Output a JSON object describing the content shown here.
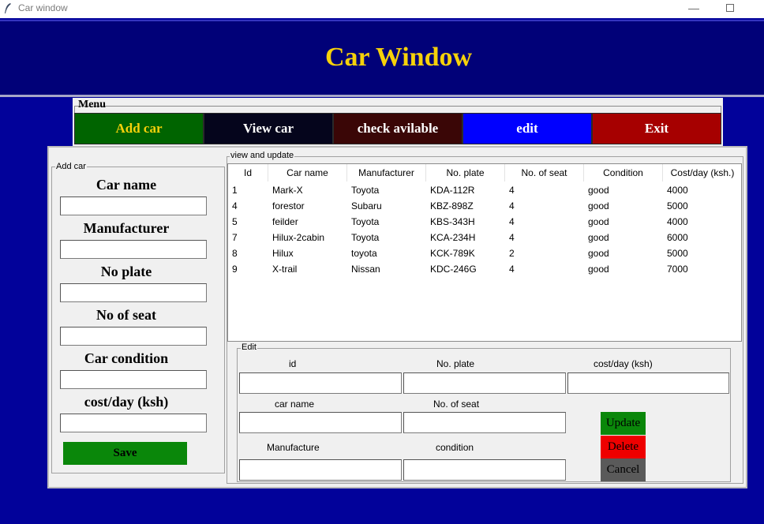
{
  "window": {
    "title": "Car window",
    "minimize_label": "—"
  },
  "header": {
    "title": "Car Window"
  },
  "menu": {
    "label": "Menu",
    "buttons": [
      {
        "label": "Add car",
        "bg": "#006400",
        "fg": "#f6d10a"
      },
      {
        "label": "View car",
        "bg": "#05051c",
        "fg": "#ffffff"
      },
      {
        "label": "check avilable",
        "bg": "#3a0606",
        "fg": "#ffffff"
      },
      {
        "label": "edit",
        "bg": "#0000ff",
        "fg": "#ffffff"
      },
      {
        "label": "Exit",
        "bg": "#a60000",
        "fg": "#ffffff"
      }
    ]
  },
  "add_car": {
    "legend": "Add car",
    "fields": [
      "Car name",
      "Manufacturer",
      "No plate",
      "No of seat",
      "Car condition",
      "cost/day (ksh)"
    ],
    "save_label": "Save"
  },
  "view": {
    "legend": "view and update",
    "columns": [
      "Id",
      "Car name",
      "Manufacturer",
      "No. plate",
      "No. of seat",
      "Condition",
      "Cost/day (ksh.)"
    ],
    "rows": [
      [
        "1",
        "Mark-X",
        "Toyota",
        "KDA-112R",
        "4",
        "good",
        "4000"
      ],
      [
        "4",
        "forestor",
        "Subaru",
        "KBZ-898Z",
        "4",
        "good",
        "5000"
      ],
      [
        "5",
        "feilder",
        "Toyota",
        "KBS-343H",
        "4",
        "good",
        "4000"
      ],
      [
        "7",
        "Hilux-2cabin",
        "Toyota",
        "KCA-234H",
        "4",
        "good",
        "6000"
      ],
      [
        "8",
        "Hilux",
        "toyota",
        "KCK-789K",
        "2",
        "good",
        "5000"
      ],
      [
        "9",
        "X-trail",
        "Nissan",
        "KDC-246G",
        "4",
        "good",
        "7000"
      ]
    ]
  },
  "edit": {
    "legend": "Edit",
    "labels": {
      "id": "id",
      "no_plate": "No. plate",
      "cost": "cost/day (ksh)",
      "car_name": "car name",
      "seats": "No. of seat",
      "manufacture": "Manufacture",
      "condition": "condition"
    },
    "buttons": {
      "update": "Update",
      "delete": "Delete",
      "cancel": "Cancel"
    }
  },
  "colors": {
    "background": "#02029a",
    "banner": "#010178",
    "title": "#f6d10a",
    "save": "#0a870a",
    "update": "#0a870a",
    "delete": "#ee0000",
    "cancel": "#5a5a5a"
  }
}
